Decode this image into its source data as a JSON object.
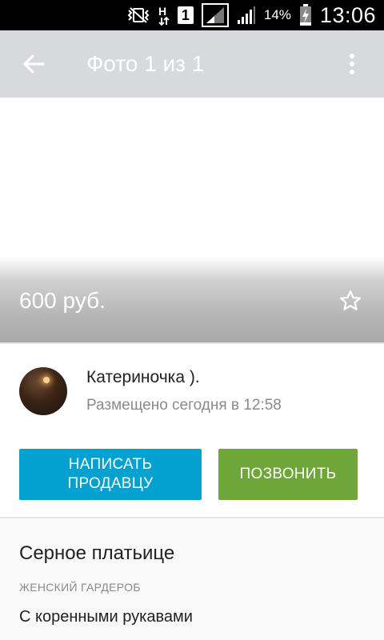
{
  "status_bar": {
    "sim_slot": "1",
    "battery_percent": "14%",
    "time": "13:06"
  },
  "app_bar": {
    "title": "Фото 1 из 1"
  },
  "listing": {
    "price": "600 руб."
  },
  "seller": {
    "name": "Катериночка ).",
    "posted": "Размещено сегодня в 12:58"
  },
  "actions": {
    "message_label_line1": "НАПИСАТЬ",
    "message_label_line2": "ПРОДАВЦУ",
    "call_label": "ПОЗВОНИТЬ"
  },
  "details": {
    "title": "Серное платьице",
    "category": "ЖЕНСКИЙ ГАРДЕРОБ",
    "description": "С коренными рукавами"
  },
  "colors": {
    "message_button": "#03a1cf",
    "call_button": "#6ea63a",
    "app_bar": "#d8d9dc"
  }
}
